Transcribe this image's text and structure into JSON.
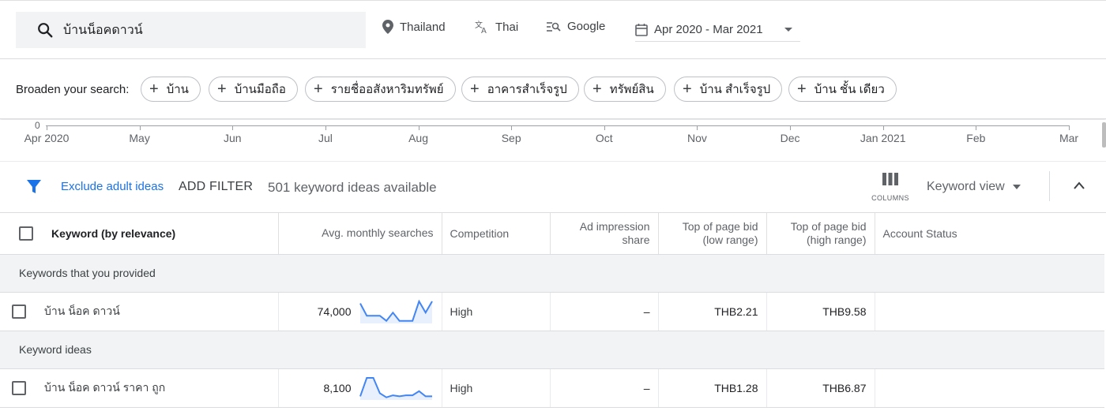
{
  "query": {
    "text": "บ้านน็อคดาวน์"
  },
  "location": "Thailand",
  "language": "Thai",
  "network": "Google",
  "date_range": "Apr 2020 - Mar 2021",
  "broaden": {
    "label": "Broaden your search:",
    "chips": [
      "บ้าน",
      "บ้านมือถือ",
      "รายชื่ออสังหาริมทรัพย์",
      "อาคารสำเร็จรูป",
      "ทรัพย์สิน",
      "บ้าน สำเร็จรูป",
      "บ้าน ชั้น เดียว"
    ]
  },
  "timeline": {
    "zero": "0",
    "months": [
      "Apr 2020",
      "May",
      "Jun",
      "Jul",
      "Aug",
      "Sep",
      "Oct",
      "Nov",
      "Dec",
      "Jan 2021",
      "Feb",
      "Mar"
    ]
  },
  "filters": {
    "exclude": "Exclude adult ideas",
    "add": "ADD FILTER",
    "available": "501 keyword ideas available",
    "columns": "COLUMNS",
    "view": "Keyword view"
  },
  "table": {
    "headers": {
      "keyword": "Keyword (by relevance)",
      "searches": "Avg. monthly searches",
      "competition": "Competition",
      "impression_1": "Ad impression",
      "impression_2": "share",
      "bid_low_1": "Top of page bid",
      "bid_low_2": "(low range)",
      "bid_high_1": "Top of page bid",
      "bid_high_2": "(high range)",
      "status": "Account Status"
    },
    "groups": [
      {
        "title": "Keywords that you provided",
        "rows": [
          {
            "keyword": "บ้าน น็อค ดาวน์",
            "searches": "74,000",
            "competition": "High",
            "impression": "–",
            "bid_low": "THB2.21",
            "bid_high": "THB9.58",
            "status": "",
            "trend": [
              0.9,
              0.3,
              0.3,
              0.3,
              0.05,
              0.45,
              0.05,
              0.05,
              0.05,
              1.0,
              0.45,
              1.0
            ]
          }
        ]
      },
      {
        "title": "Keyword ideas",
        "rows": [
          {
            "keyword": "บ้าน น็อค ดาวน์ ราคา ถูก",
            "searches": "8,100",
            "competition": "High",
            "impression": "–",
            "bid_low": "THB1.28",
            "bid_high": "THB6.87",
            "status": "",
            "trend": [
              0.1,
              1.0,
              1.0,
              0.25,
              0.05,
              0.15,
              0.1,
              0.15,
              0.15,
              0.35,
              0.1,
              0.1
            ]
          }
        ]
      }
    ]
  },
  "colors": {
    "accent": "#1a73e8",
    "sparkline": "#4285f4"
  }
}
